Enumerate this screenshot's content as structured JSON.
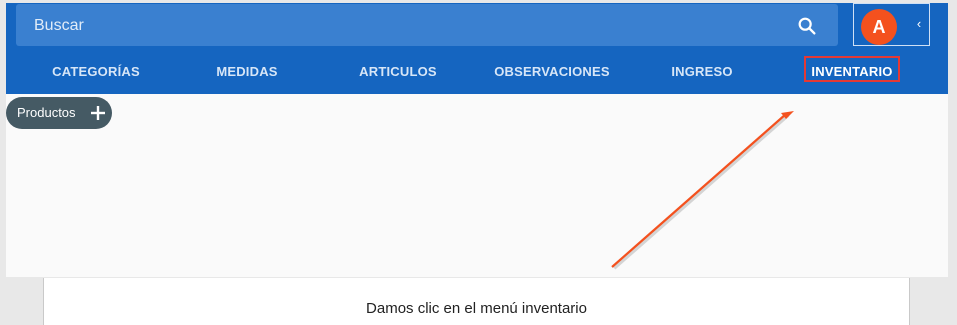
{
  "search": {
    "placeholder": "Buscar"
  },
  "user": {
    "avatar_letter": "A",
    "collapse_glyph": "‹"
  },
  "nav": {
    "items": [
      {
        "label": "CATEGORÍAS"
      },
      {
        "label": "MEDIDAS"
      },
      {
        "label": "ARTICULOS"
      },
      {
        "label": "OBSERVACIONES"
      },
      {
        "label": "INGRESO"
      },
      {
        "label": "INVENTARIO"
      }
    ]
  },
  "chip": {
    "label": "Productos"
  },
  "caption": "Damos clic en el menú inventario",
  "colors": {
    "primary": "#1565c0",
    "search_bg": "#3a80d0",
    "avatar": "#f4511e",
    "highlight": "#e53935",
    "chip_bg": "#455a64"
  },
  "icons": [
    "search-icon",
    "plus-icon",
    "chevron-left-icon"
  ]
}
